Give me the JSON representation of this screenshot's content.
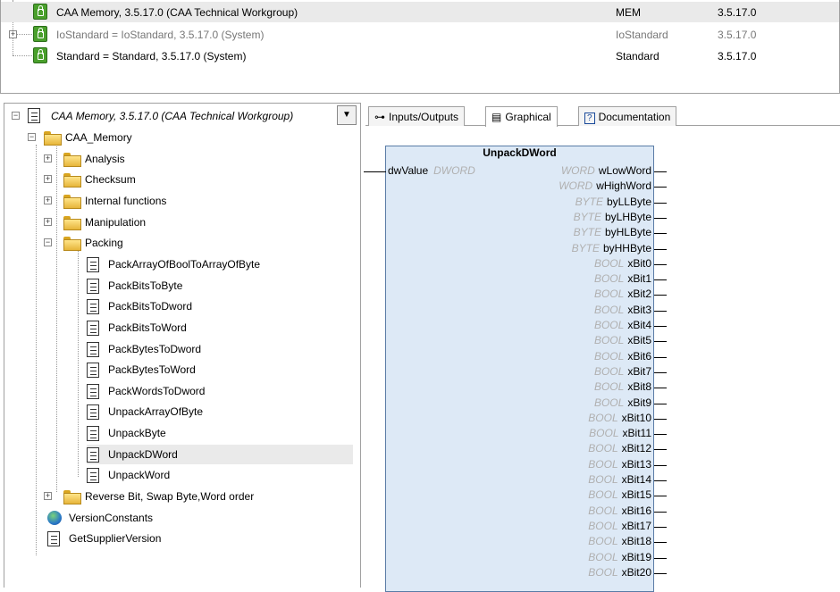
{
  "libraries": [
    {
      "name": "CAA Memory, 3.5.17.0 (CAA Technical Workgroup)",
      "namespace": "MEM",
      "version": "3.5.17.0",
      "selected": true,
      "dim": false
    },
    {
      "name": "IoStandard = IoStandard, 3.5.17.0 (System)",
      "namespace": "IoStandard",
      "version": "3.5.17.0",
      "selected": false,
      "dim": true
    },
    {
      "name": "Standard = Standard, 3.5.17.0 (System)",
      "namespace": "Standard",
      "version": "3.5.17.0",
      "selected": false,
      "dim": false
    }
  ],
  "tree": {
    "root_title": "CAA Memory, 3.5.17.0 (CAA Technical Workgroup)",
    "dropdown_icon": "▼",
    "items": [
      {
        "label": "CAA_Memory",
        "icon": "folder-icon",
        "expander": "minus"
      },
      {
        "label": "Analysis",
        "icon": "folder-icon",
        "expander": "plus"
      },
      {
        "label": "Checksum",
        "icon": "folder-icon",
        "expander": "plus"
      },
      {
        "label": "Internal functions",
        "icon": "folder-icon",
        "expander": "plus"
      },
      {
        "label": "Manipulation",
        "icon": "folder-icon",
        "expander": "plus"
      },
      {
        "label": "Packing",
        "icon": "folder-icon",
        "expander": "minus"
      },
      {
        "label": "PackArrayOfBoolToArrayOfByte",
        "icon": "document-icon"
      },
      {
        "label": "PackBitsToByte",
        "icon": "document-icon"
      },
      {
        "label": "PackBitsToDword",
        "icon": "document-icon"
      },
      {
        "label": "PackBitsToWord",
        "icon": "document-icon"
      },
      {
        "label": "PackBytesToDword",
        "icon": "document-icon"
      },
      {
        "label": "PackBytesToWord",
        "icon": "document-icon"
      },
      {
        "label": "PackWordsToDword",
        "icon": "document-icon"
      },
      {
        "label": "UnpackArrayOfByte",
        "icon": "document-icon"
      },
      {
        "label": "UnpackByte",
        "icon": "document-icon"
      },
      {
        "label": "UnpackDWord",
        "icon": "document-icon",
        "selected": true
      },
      {
        "label": "UnpackWord",
        "icon": "document-icon"
      },
      {
        "label": "Reverse Bit, Swap Byte,Word order",
        "icon": "folder-icon",
        "expander": "plus"
      },
      {
        "label": "VersionConstants",
        "icon": "globe-icon"
      },
      {
        "label": "GetSupplierVersion",
        "icon": "document-icon"
      }
    ]
  },
  "tabs": [
    {
      "label": "Inputs/Outputs",
      "icon": "⊶",
      "active": false
    },
    {
      "label": "Graphical",
      "icon": "▤",
      "active": true
    },
    {
      "label": "Documentation",
      "icon": "?",
      "active": false
    }
  ],
  "function_block": {
    "name": "UnpackDWord",
    "inputs": [
      {
        "name": "dwValue",
        "type": "DWORD"
      }
    ],
    "outputs": [
      {
        "type": "WORD",
        "name": "wLowWord"
      },
      {
        "type": "WORD",
        "name": "wHighWord"
      },
      {
        "type": "BYTE",
        "name": "byLLByte"
      },
      {
        "type": "BYTE",
        "name": "byLHByte"
      },
      {
        "type": "BYTE",
        "name": "byHLByte"
      },
      {
        "type": "BYTE",
        "name": "byHHByte"
      },
      {
        "type": "BOOL",
        "name": "xBit0"
      },
      {
        "type": "BOOL",
        "name": "xBit1"
      },
      {
        "type": "BOOL",
        "name": "xBit2"
      },
      {
        "type": "BOOL",
        "name": "xBit3"
      },
      {
        "type": "BOOL",
        "name": "xBit4"
      },
      {
        "type": "BOOL",
        "name": "xBit5"
      },
      {
        "type": "BOOL",
        "name": "xBit6"
      },
      {
        "type": "BOOL",
        "name": "xBit7"
      },
      {
        "type": "BOOL",
        "name": "xBit8"
      },
      {
        "type": "BOOL",
        "name": "xBit9"
      },
      {
        "type": "BOOL",
        "name": "xBit10"
      },
      {
        "type": "BOOL",
        "name": "xBit11"
      },
      {
        "type": "BOOL",
        "name": "xBit12"
      },
      {
        "type": "BOOL",
        "name": "xBit13"
      },
      {
        "type": "BOOL",
        "name": "xBit14"
      },
      {
        "type": "BOOL",
        "name": "xBit15"
      },
      {
        "type": "BOOL",
        "name": "xBit16"
      },
      {
        "type": "BOOL",
        "name": "xBit17"
      },
      {
        "type": "BOOL",
        "name": "xBit18"
      },
      {
        "type": "BOOL",
        "name": "xBit19"
      },
      {
        "type": "BOOL",
        "name": "xBit20"
      }
    ]
  },
  "colors": {
    "fb_fill": "#dde9f6",
    "fb_border": "#5a7ca6",
    "selection": "#eaeaea",
    "type_text": "#b0b0b0"
  }
}
